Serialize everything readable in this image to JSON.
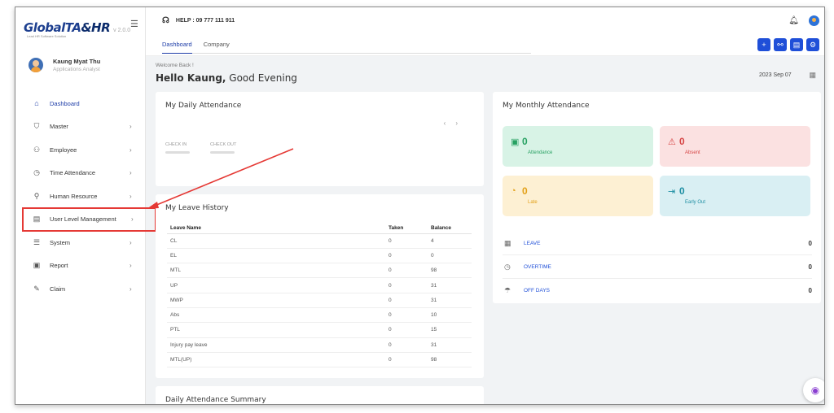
{
  "app": {
    "logo_text": "GlobalTA",
    "logo_text_hr": "&HR",
    "version": "v 2.0.0",
    "logo_subtitle": "Lead HR Software Solution"
  },
  "user": {
    "name": "Kaung Myat Thu",
    "role": "Applications Analyst"
  },
  "sidebar": {
    "items": [
      {
        "label": "Dashboard",
        "icon": "home-icon",
        "glyph": "⌂"
      },
      {
        "label": "Master",
        "icon": "shield-icon",
        "glyph": "⛉"
      },
      {
        "label": "Employee",
        "icon": "users-icon",
        "glyph": "⚇"
      },
      {
        "label": "Time Attendance",
        "icon": "clock-icon",
        "glyph": "◷"
      },
      {
        "label": "Human Resource",
        "icon": "user-list-icon",
        "glyph": "⚲"
      },
      {
        "label": "User Level Management",
        "icon": "id-card-icon",
        "glyph": "▤"
      },
      {
        "label": "System",
        "icon": "sliders-icon",
        "glyph": "☰"
      },
      {
        "label": "Report",
        "icon": "report-icon",
        "glyph": "▣"
      },
      {
        "label": "Claim",
        "icon": "claim-icon",
        "glyph": "✎"
      }
    ],
    "chevron": "›"
  },
  "header": {
    "help": "HELP : 09 777 111 911",
    "tabs": [
      {
        "label": "Dashboard"
      },
      {
        "label": "Company"
      }
    ]
  },
  "greeting": {
    "welcome": "Welcome Back !",
    "hello_name": "Hello Kaung,",
    "hello_suffix": " Good Evening"
  },
  "date": "2023 Sep 07",
  "daily_attendance": {
    "title": "My Daily Attendance",
    "check_in": "CHECK IN",
    "check_out": "CHECK OUT"
  },
  "leave_history": {
    "title": "My Leave History",
    "columns": [
      "Leave Name",
      "Taken",
      "Balance"
    ],
    "rows": [
      [
        "CL",
        "0",
        "4"
      ],
      [
        "EL",
        "0",
        "0"
      ],
      [
        "MTL",
        "0",
        "98"
      ],
      [
        "UP",
        "0",
        "31"
      ],
      [
        "MWP",
        "0",
        "31"
      ],
      [
        "Abs",
        "0",
        "10"
      ],
      [
        "PTL",
        "0",
        "15"
      ],
      [
        "Injury pay leave",
        "0",
        "31"
      ],
      [
        "MTL(UP)",
        "0",
        "98"
      ]
    ]
  },
  "summary": {
    "title": "Daily Attendance Summary"
  },
  "monthly": {
    "title": "My Monthly Attendance",
    "tiles": {
      "attendance": {
        "value": "0",
        "label": "Attendance"
      },
      "absent": {
        "value": "0",
        "label": "Absent"
      },
      "late": {
        "value": "0",
        "label": "Late"
      },
      "early_out": {
        "value": "0",
        "label": "Early Out"
      }
    },
    "stats": {
      "leave": {
        "label": "LEAVE",
        "value": "0"
      },
      "overtime": {
        "label": "OVERTIME",
        "value": "0"
      },
      "off_days": {
        "label": "OFF DAYS",
        "value": "0"
      }
    }
  },
  "colors": {
    "accent": "#1f4fd8",
    "highlight": "#e53935"
  }
}
